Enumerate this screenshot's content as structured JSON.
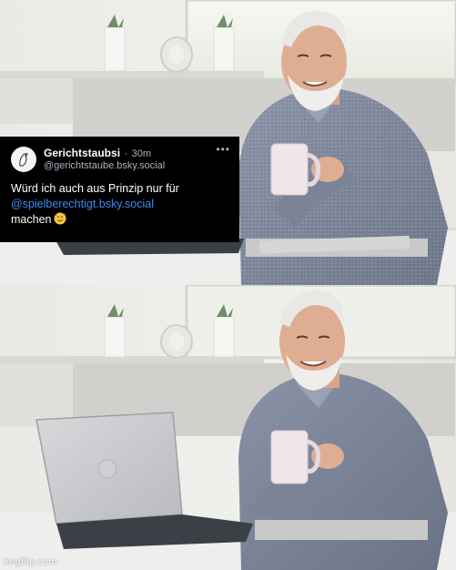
{
  "tweet": {
    "display_name": "Gerichtstaubsi",
    "separator": "·",
    "time": "30m",
    "handle": "@gerichtstaube.bsky.social",
    "more": "•••",
    "text_line1": "Würd ich auch aus Prinzip nur für",
    "mention": "@spielberechtigt.bsky.social",
    "text_line3": "machen",
    "emoji": "smiling-face-with-hearts"
  },
  "watermark": "imgflip.com",
  "colors": {
    "tweet_background": "#000000",
    "mention": "#3d8bf2",
    "meta_text": "#a9b4c0"
  }
}
